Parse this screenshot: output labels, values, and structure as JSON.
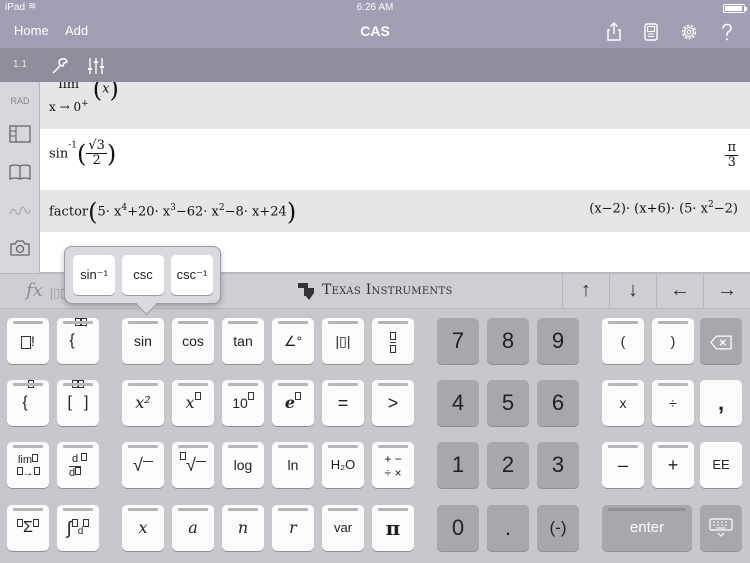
{
  "status": {
    "carrier": "iPad",
    "time": "6:26 AM"
  },
  "nav": {
    "home": "Home",
    "add": "Add",
    "title": "CAS"
  },
  "sidebar": {
    "page_id": "1.1",
    "mode": "RAD"
  },
  "history": {
    "row1": {
      "lim_word": "lim",
      "lim_sub": "x → 0",
      "lim_sub_sign": "+",
      "arg": "x"
    },
    "row2": {
      "fn": "sin",
      "fn_exp": "-1",
      "num": "√3",
      "den": "2",
      "res_num": "π",
      "res_den": "3"
    },
    "row3": {
      "fn": "factor",
      "expr": [
        "5· x",
        "4",
        "+20· x",
        "3",
        "−62· x",
        "2",
        "−8· x+24"
      ],
      "result": [
        "(x−2)· (x+6)· (5· x",
        "2",
        "−2)"
      ]
    }
  },
  "keypad_header": {
    "fx": "fx",
    "template": "[▯▯",
    "brand": "Texas Instruments",
    "arrows": [
      "↑",
      "↓",
      "←",
      "→"
    ]
  },
  "popup": {
    "items": [
      "sin⁻¹",
      "csc",
      "csc⁻¹"
    ]
  },
  "keys": {
    "factorial": "!",
    "sin": "sin",
    "cos": "cos",
    "tan": "tan",
    "angle": "∠°",
    "abs": "|▯|",
    "x2": "x²",
    "x_pow": "x",
    "ten_pow": "10",
    "e_pow": "e",
    "equals": "=",
    "greater": ">",
    "lim": "lim",
    "deriv": "d",
    "sqrt": "√",
    "nthroot": "√",
    "log": "log",
    "ln": "ln",
    "chem": "H₂O",
    "ops": "+ −\n÷ ×",
    "sum": "Σ",
    "integral": "∫",
    "x": "x",
    "a": "a",
    "n": "n",
    "r": "r",
    "var": "var",
    "pi": "π",
    "d7": "7",
    "d8": "8",
    "d9": "9",
    "d4": "4",
    "d5": "5",
    "d6": "6",
    "d1": "1",
    "d2": "2",
    "d3": "3",
    "d0": "0",
    "dot": ".",
    "neg": "(-)",
    "lparen": "(",
    "rparen": ")",
    "times": "x",
    "divide": "÷",
    "comma": ",",
    "minus": "–",
    "plus": "+",
    "ee": "EE",
    "enter": "enter"
  }
}
